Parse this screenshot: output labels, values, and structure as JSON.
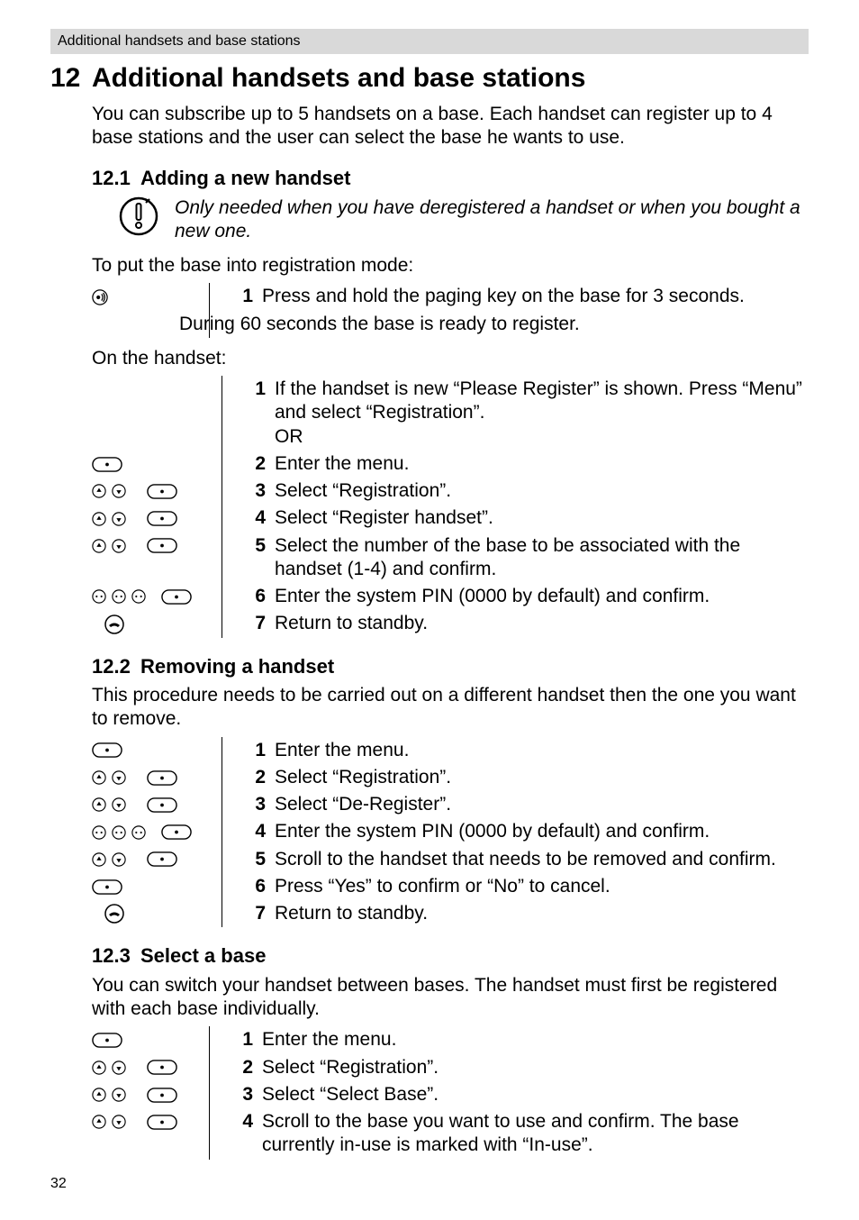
{
  "header": {
    "running": "Additional handsets and base stations"
  },
  "section": {
    "num": "12",
    "title": "Additional handsets and base stations",
    "intro": "You can subscribe up to 5 handsets on a base. Each handset can register up to 4 base stations and the user can select the base he wants to use."
  },
  "s12_1": {
    "num": "12.1",
    "title": "Adding a new handset",
    "note": "Only needed when you have deregistered a handset or when you bought a new one.",
    "lead1": "To put the base into registration mode:",
    "base_steps": [
      {
        "n": "1",
        "t": "Press and hold the paging key on the base for 3 seconds."
      }
    ],
    "base_after": "During 60 seconds the base is ready to register.",
    "lead2": "On the handset:",
    "hs_steps": [
      {
        "n": "1",
        "t": "If the handset is new “Please Register” is shown. Press “Menu” and select “Registration”.",
        "after": "OR"
      },
      {
        "n": "2",
        "t": "Enter the menu."
      },
      {
        "n": "3",
        "t": "Select “Registration”."
      },
      {
        "n": "4",
        "t": "Select “Register handset”."
      },
      {
        "n": "5",
        "t": "Select the number of the base to be associated with the handset (1-4) and confirm."
      },
      {
        "n": "6",
        "t": "Enter the system PIN (0000 by default) and confirm."
      },
      {
        "n": "7",
        "t": "Return to standby."
      }
    ]
  },
  "s12_2": {
    "num": "12.2",
    "title": "Removing a handset",
    "intro": "This procedure needs to be carried out on a different handset then the one you want to remove.",
    "steps": [
      {
        "n": "1",
        "t": "Enter the menu."
      },
      {
        "n": "2",
        "t": "Select “Registration”."
      },
      {
        "n": "3",
        "t": "Select “De-Register”."
      },
      {
        "n": "4",
        "t": "Enter the system PIN (0000 by default) and confirm."
      },
      {
        "n": "5",
        "t": "Scroll to the handset that needs to be removed and confirm."
      },
      {
        "n": "6",
        "t": "Press “Yes” to confirm or “No” to cancel."
      },
      {
        "n": "7",
        "t": "Return to standby."
      }
    ]
  },
  "s12_3": {
    "num": "12.3",
    "title": "Select a base",
    "intro": "You can switch your handset between bases. The handset must first be registered with each base individually.",
    "steps": [
      {
        "n": "1",
        "t": "Enter the menu."
      },
      {
        "n": "2",
        "t": "Select “Registration”."
      },
      {
        "n": "3",
        "t": "Select “Select Base”."
      },
      {
        "n": "4",
        "t": "Scroll to the base you want to use and confirm. The base currently in-use is marked with “In-use”."
      }
    ]
  },
  "page_number": "32"
}
